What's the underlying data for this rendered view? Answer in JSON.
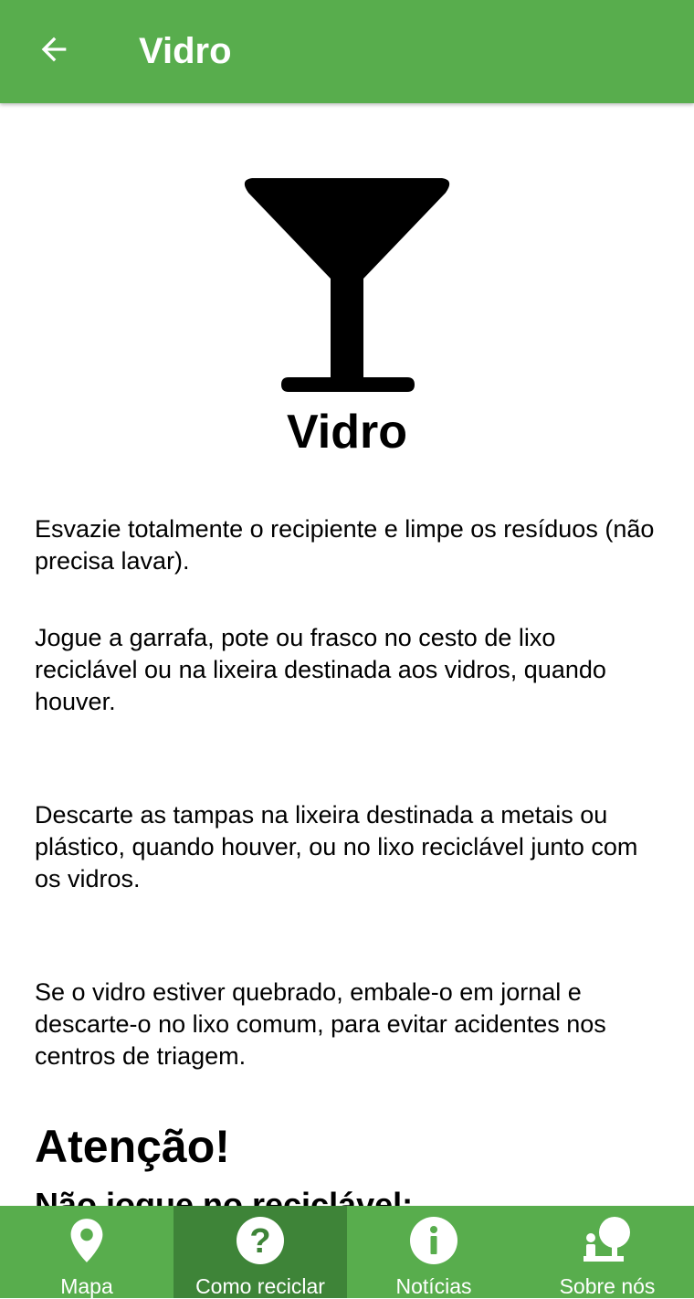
{
  "app_bar": {
    "back_icon": "arrow-back-icon",
    "title": "Vidro",
    "background_color": "#58AD4D"
  },
  "material": {
    "icon": "wine-glass-icon",
    "title": "Vidro"
  },
  "tips": [
    "Esvazie totalmente o recipiente e limpe os resíduos (não precisa lavar).",
    "Jogue a garrafa, pote ou frasco no cesto de lixo reciclável ou na lixeira destinada aos vidros, quando houver.",
    "Descarte as tampas na lixeira destinada a metais ou plástico, quando houver, ou no lixo reciclável junto com os vidros.",
    "Se o vidro estiver quebrado, embale-o em jornal e descarte-o no lixo comum, para evitar acidentes nos centros de triagem."
  ],
  "warning": {
    "title": "Atenção!",
    "subtitle": "Não jogue no reciclável:"
  },
  "bottom_nav": {
    "active_color": "#3E8438",
    "items": [
      {
        "label": "Mapa",
        "icon": "map-pin-icon",
        "active": false
      },
      {
        "label": "Como reciclar",
        "icon": "help-circle-icon",
        "active": true
      },
      {
        "label": "Notícias",
        "icon": "info-circle-icon",
        "active": false
      },
      {
        "label": "Sobre nós",
        "icon": "about-us-icon",
        "active": false
      }
    ]
  }
}
